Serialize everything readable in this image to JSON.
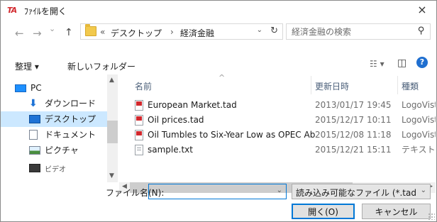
{
  "window": {
    "app_icon": "TA",
    "title": "ﾌｧｲﾙを開く",
    "close_glyph": "×"
  },
  "address": {
    "back_glyph": "←",
    "forward_glyph": "→",
    "recent_glyph": "⌄",
    "up_glyph": "↑",
    "chevron": "«",
    "path": [
      "デスクトップ",
      "経済金融"
    ],
    "separator": "›",
    "dropdown_glyph": "⌄",
    "refresh_glyph": "↻"
  },
  "search": {
    "placeholder": "経済金融の検索",
    "icon": "search-icon"
  },
  "toolbar": {
    "organize_label": "整理 ▾",
    "new_folder_label": "新しいフォルダー",
    "view_glyph": "☷ ▾",
    "pane_glyph": "◫",
    "help_glyph": "?"
  },
  "tree": [
    {
      "label": "PC",
      "icon": "pc-icon",
      "selected": false
    },
    {
      "label": "ダウンロード",
      "icon": "download-icon",
      "selected": false
    },
    {
      "label": "デスクトップ",
      "icon": "desktop-icon",
      "selected": true
    },
    {
      "label": "ドキュメント",
      "icon": "document-icon",
      "selected": false
    },
    {
      "label": "ピクチャ",
      "icon": "picture-icon",
      "selected": false
    },
    {
      "label": "ビデオ",
      "icon": "video-icon",
      "selected": false
    }
  ],
  "columns": {
    "name": "名前",
    "date": "更新日時",
    "type": "種類",
    "sort_glyph": "^"
  },
  "files": [
    {
      "name": "European Market.tad",
      "date": "2013/01/17 19:45",
      "type": "LogoVista",
      "icon": "tad-file-icon"
    },
    {
      "name": "Oil prices.tad",
      "date": "2015/12/17 10:11",
      "type": "LogoVista",
      "icon": "tad-file-icon"
    },
    {
      "name": "Oil Tumbles to Six-Year Low as OPEC Aba...",
      "date": "2015/12/08 11:18",
      "type": "LogoVista",
      "icon": "tad-file-icon"
    },
    {
      "name": "sample.txt",
      "date": "2015/12/21 15:11",
      "type": "テキスト ドキ",
      "icon": "text-file-icon"
    }
  ],
  "bottom": {
    "filename_label": "ファイル名(N):",
    "filename_value": "",
    "filter_value": "読み込み可能なファイル (*.tad;*.w",
    "open_label": "開く(O)",
    "cancel_label": "キャンセル"
  },
  "colors": {
    "accent": "#0078d7",
    "selection": "#cce8ff",
    "brand_red": "#d2282d"
  }
}
